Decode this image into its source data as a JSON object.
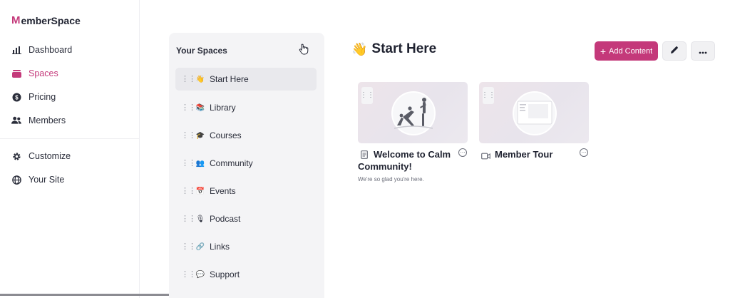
{
  "brand": {
    "logo_letter": "M",
    "name": "emberSpace",
    "accent": "#c4397a"
  },
  "nav": {
    "items": [
      {
        "label": "Dashboard",
        "icon": "chart-icon"
      },
      {
        "label": "Spaces",
        "icon": "spaces-icon",
        "active": true
      },
      {
        "label": "Pricing",
        "icon": "dollar-icon"
      },
      {
        "label": "Members",
        "icon": "members-icon"
      }
    ],
    "secondary": [
      {
        "label": "Customize",
        "icon": "gear-icon"
      },
      {
        "label": "Your Site",
        "icon": "globe-icon"
      }
    ]
  },
  "spaces_panel": {
    "title": "Your Spaces",
    "items": [
      {
        "label": "Start Here",
        "emoji": "👋",
        "active": true
      },
      {
        "label": "Library",
        "emoji": "📚"
      },
      {
        "label": "Courses",
        "emoji": "🎓"
      },
      {
        "label": "Community",
        "emoji": "👥"
      },
      {
        "label": "Events",
        "emoji": "📅"
      },
      {
        "label": "Podcast",
        "emoji": "🎙"
      },
      {
        "label": "Links",
        "emoji": "🔗"
      },
      {
        "label": "Support",
        "emoji": "💬"
      }
    ]
  },
  "main": {
    "emoji": "👋",
    "title": "Start Here",
    "add_button": "Add Content",
    "cards": [
      {
        "title_line1": "Welcome to Calm",
        "title_line2": "Community!",
        "subtitle": "We're so glad you're here.",
        "type_icon": "document-icon"
      },
      {
        "title_line1": "Member Tour",
        "title_line2": "",
        "subtitle": "",
        "type_icon": "video-icon"
      }
    ]
  }
}
